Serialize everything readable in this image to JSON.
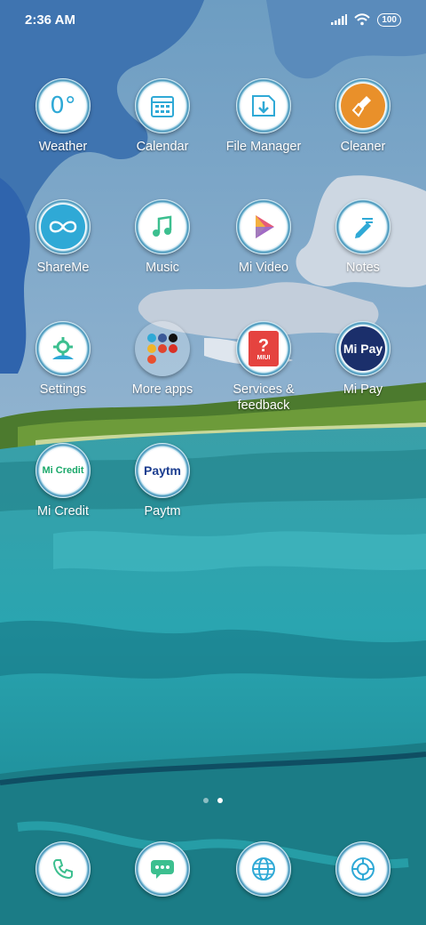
{
  "status_bar": {
    "time": "2:36 AM",
    "battery": "100",
    "signal_icon": "cellular-signal-icon",
    "wifi_icon": "wifi-icon"
  },
  "apps": [
    {
      "label": "Weather",
      "icon": "weather-icon",
      "glyph": "0°"
    },
    {
      "label": "Calendar",
      "icon": "calendar-icon"
    },
    {
      "label": "File Manager",
      "icon": "file-manager-icon"
    },
    {
      "label": "Cleaner",
      "icon": "broom-icon"
    },
    {
      "label": "ShareMe",
      "icon": "infinity-icon"
    },
    {
      "label": "Music",
      "icon": "music-note-icon"
    },
    {
      "label": "Mi Video",
      "icon": "play-icon"
    },
    {
      "label": "Notes",
      "icon": "pencil-icon"
    },
    {
      "label": "Settings",
      "icon": "gear-icon"
    },
    {
      "label": "More apps",
      "icon": "folder-icon"
    },
    {
      "label": "Services & feedback",
      "icon": "question-icon",
      "glyph": "MIUI"
    },
    {
      "label": "Mi Pay",
      "icon": "mi-pay-icon",
      "glyph": "Mi Pay"
    },
    {
      "label": "Mi Credit",
      "icon": "mi-credit-icon",
      "glyph": "Mi Credit"
    },
    {
      "label": "Paytm",
      "icon": "paytm-icon",
      "glyph": "Paytm"
    }
  ],
  "page_indicator": {
    "pages": 2,
    "active": 2
  },
  "dock": [
    {
      "name": "phone",
      "icon": "phone-icon"
    },
    {
      "name": "messages",
      "icon": "message-icon"
    },
    {
      "name": "browser",
      "icon": "globe-icon"
    },
    {
      "name": "camera",
      "icon": "camera-icon"
    }
  ],
  "colors": {
    "label": "#ffffff",
    "accent": "#2fa9d6"
  }
}
